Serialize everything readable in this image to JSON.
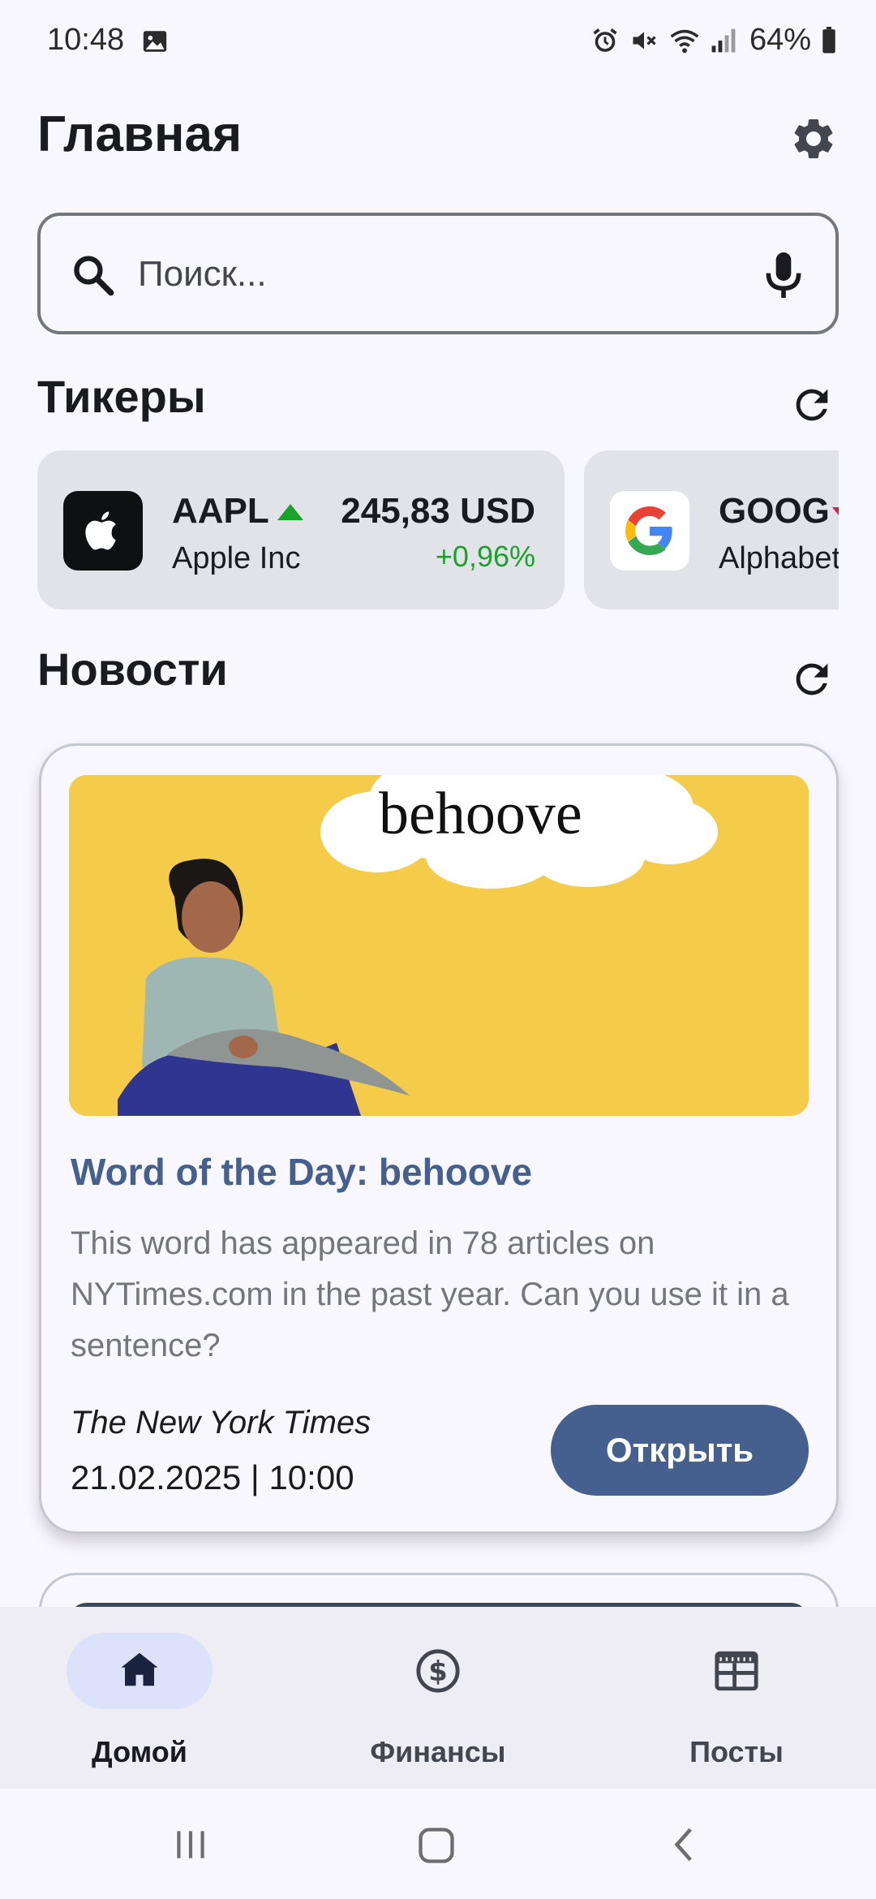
{
  "status_bar": {
    "time": "10:48",
    "battery": "64%"
  },
  "header": {
    "title": "Главная"
  },
  "search": {
    "placeholder": "Поиск..."
  },
  "tickers": {
    "section_title": "Тикеры",
    "items": [
      {
        "symbol": "AAPL",
        "name": "Apple Inc",
        "price": "245,83 USD",
        "change": "+0,96%",
        "trend": "up",
        "logo": "apple-icon"
      },
      {
        "symbol": "GOOG",
        "name": "Alphabet",
        "trend": "down",
        "logo": "google-icon"
      }
    ]
  },
  "news": {
    "section_title": "Новости",
    "items": [
      {
        "image_word": "behoove",
        "title": "Word of the Day: behoove",
        "description": "This word has appeared in 78 articles on NYTimes.com in the past year. Can you use it in a sentence?",
        "source": "The New York Times",
        "date": "21.02.2025 | 10:00",
        "button_label": "Открыть"
      }
    ]
  },
  "bottom_nav": {
    "items": [
      {
        "label": "Домой",
        "icon": "home-icon",
        "active": true
      },
      {
        "label": "Финансы",
        "icon": "dollar-icon",
        "active": false
      },
      {
        "label": "Посты",
        "icon": "newspaper-icon",
        "active": false
      }
    ]
  },
  "colors": {
    "accent": "#45608f",
    "positive": "#1aa32a",
    "background": "#f8f7fd",
    "card": "#e2e2e9",
    "image_bg": "#f5cc49"
  }
}
